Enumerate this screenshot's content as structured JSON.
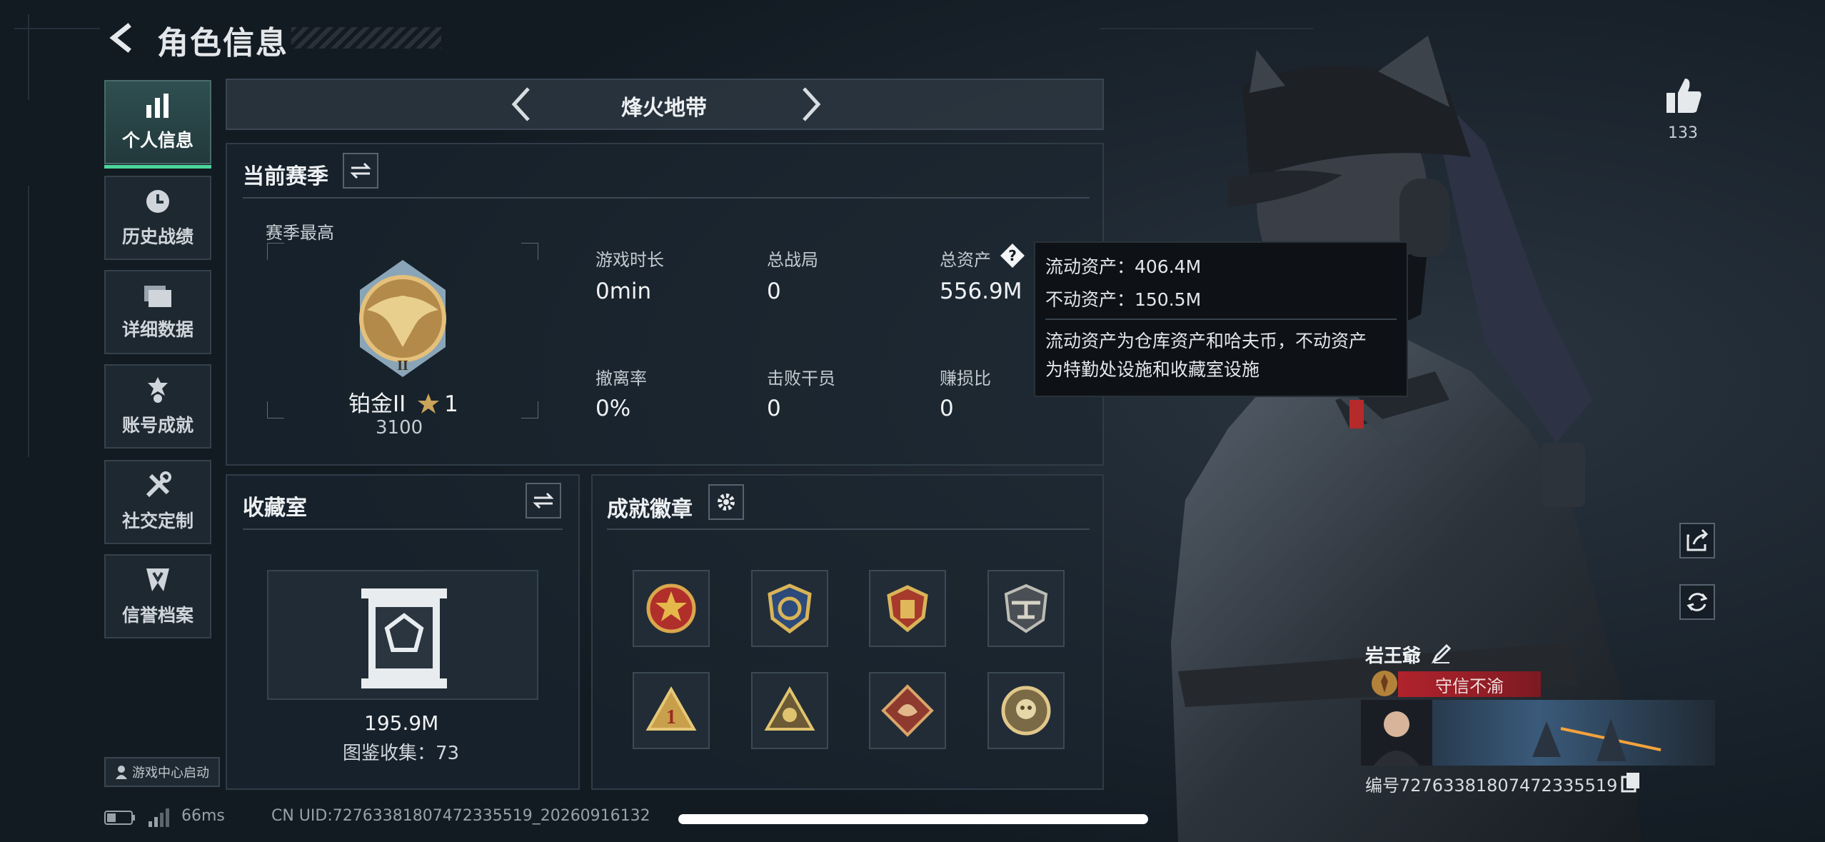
{
  "header": {
    "title": "角色信息"
  },
  "sidebar": {
    "items": [
      {
        "label": "个人信息",
        "icon": "bar-chart-icon",
        "active": true
      },
      {
        "label": "历史战绩",
        "icon": "clock-icon",
        "active": false
      },
      {
        "label": "详细数据",
        "icon": "folder-icon",
        "active": false
      },
      {
        "label": "账号成就",
        "icon": "medal-icon",
        "active": false
      },
      {
        "label": "社交定制",
        "icon": "tools-icon",
        "active": false
      },
      {
        "label": "信誉档案",
        "icon": "shield-icon",
        "active": false
      }
    ],
    "game_center": "游戏中心启动"
  },
  "mode": {
    "name": "烽火地带"
  },
  "season": {
    "title": "当前赛季",
    "best_label": "赛季最高",
    "rank": {
      "name": "铂金II",
      "stars": "1",
      "score": "3100"
    },
    "stats": [
      {
        "label": "游戏时长",
        "value": "0min"
      },
      {
        "label": "总战局",
        "value": "0"
      },
      {
        "label": "总资产",
        "value": "556.9M"
      },
      {
        "label": "撤离率",
        "value": "0%"
      },
      {
        "label": "击败干员",
        "value": "0"
      },
      {
        "label": "赚损比",
        "value": "0"
      }
    ]
  },
  "tooltip": {
    "liquid": "流动资产：406.4M",
    "fixed": "不动资产：150.5M",
    "desc1": "流动资产为仓库资产和哈夫币，不动资产",
    "desc2": "为特勤处设施和收藏室设施"
  },
  "collection": {
    "title": "收藏室",
    "value": "195.9M",
    "count": "图鉴收集：73"
  },
  "achievements": {
    "title": "成就徽章",
    "badges": [
      "star-badge-icon",
      "eagle-badge-icon",
      "shield-badge-icon",
      "helicopter-badge-icon",
      "number-one-badge-icon",
      "triangle-badge-icon",
      "dragon-badge-icon",
      "skull-badge-icon"
    ]
  },
  "profile": {
    "likes": "133",
    "name": "岩王爺",
    "motto": "守信不渝",
    "uid": "编号7276338180747233551​9"
  },
  "status": {
    "latency": "66ms",
    "cn_uid": "CN UID:7276338180747233551​9_20260916132"
  },
  "colors": {
    "accent": "#4bd49a",
    "motto_red": "#b1232c",
    "bg": "#121a22"
  }
}
